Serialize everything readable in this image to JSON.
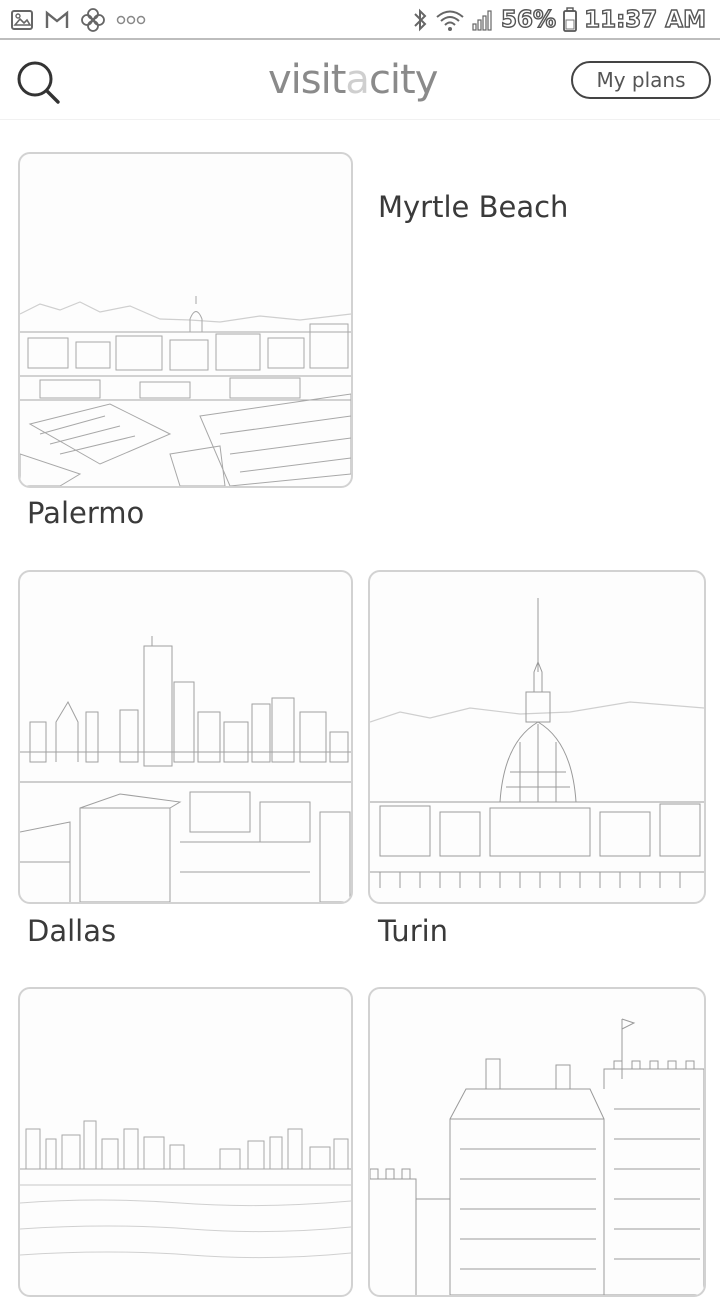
{
  "status_bar": {
    "left_icons": [
      "image-icon",
      "gmail-icon",
      "pinwheel-icon",
      "more-dots-icon"
    ],
    "right_icons": [
      "bluetooth-icon",
      "wifi-icon",
      "signal-icon",
      "battery-icon"
    ],
    "battery": "56%",
    "time": "11:37 AM"
  },
  "header": {
    "logo": {
      "part1": "visit",
      "part2": "a",
      "part3": "city"
    },
    "my_plans_label": "My plans",
    "search_icon": "search-icon"
  },
  "cities": [
    {
      "name": "Palermo",
      "has_image": true
    },
    {
      "name": "Myrtle Beach",
      "has_image": false
    },
    {
      "name": "Dallas",
      "has_image": true
    },
    {
      "name": "Turin",
      "has_image": true
    },
    {
      "name": "",
      "has_image": true
    },
    {
      "name": "",
      "has_image": true
    }
  ]
}
